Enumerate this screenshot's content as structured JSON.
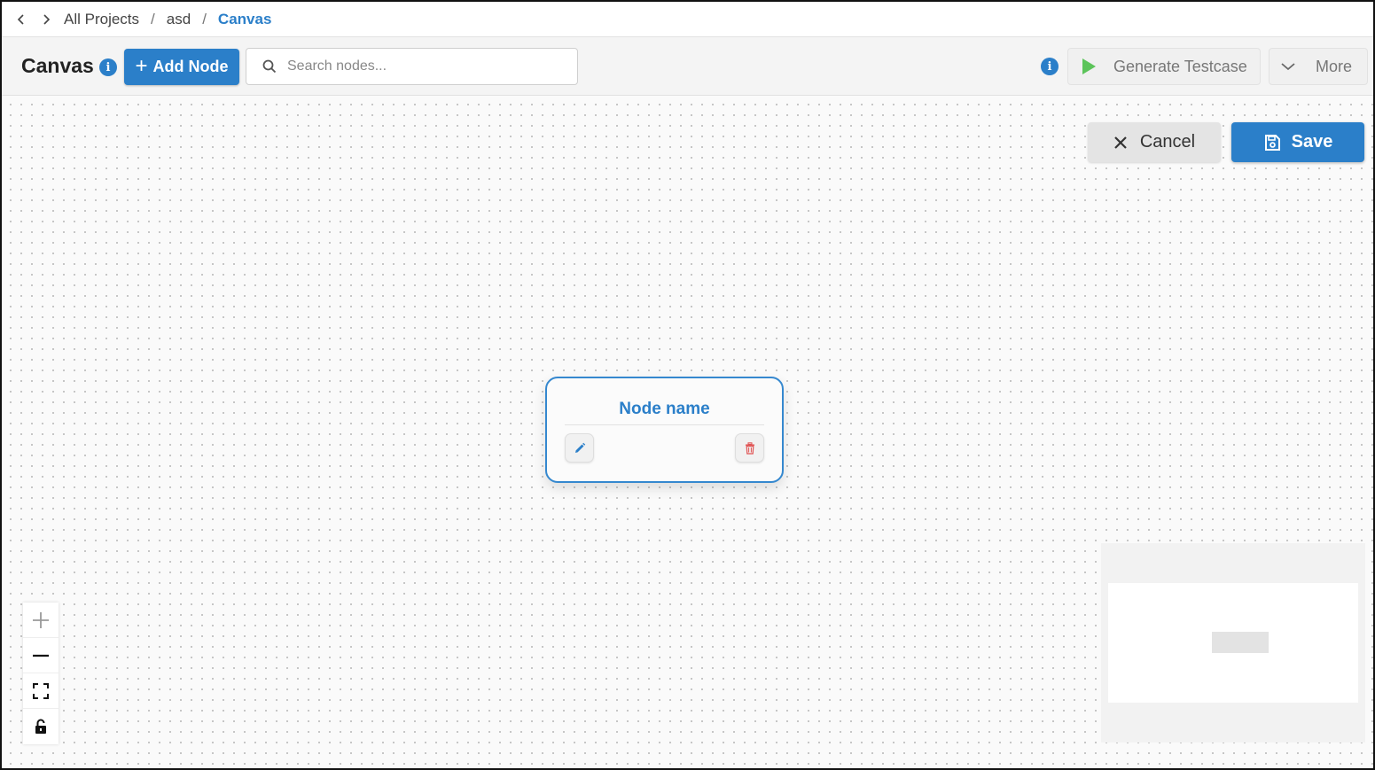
{
  "breadcrumb": {
    "back_icon": "chevron-left-icon",
    "forward_icon": "chevron-right-icon",
    "items": [
      "All Projects",
      "asd",
      "Canvas"
    ],
    "separator": "/"
  },
  "toolbar": {
    "title": "Canvas",
    "title_info_icon": "info-icon",
    "add_node_label": "Add Node",
    "search_placeholder": "Search nodes...",
    "generate_label": "Generate Testcase",
    "more_label": "More",
    "accent_color": "#2b7fc9"
  },
  "canvas": {
    "cancel_label": "Cancel",
    "save_label": "Save",
    "node": {
      "name": "Node name",
      "edit_icon": "pencil-icon",
      "delete_icon": "trash-icon"
    },
    "controls": [
      "zoom-in-icon",
      "zoom-out-icon",
      "fit-view-icon",
      "lock-icon"
    ]
  }
}
